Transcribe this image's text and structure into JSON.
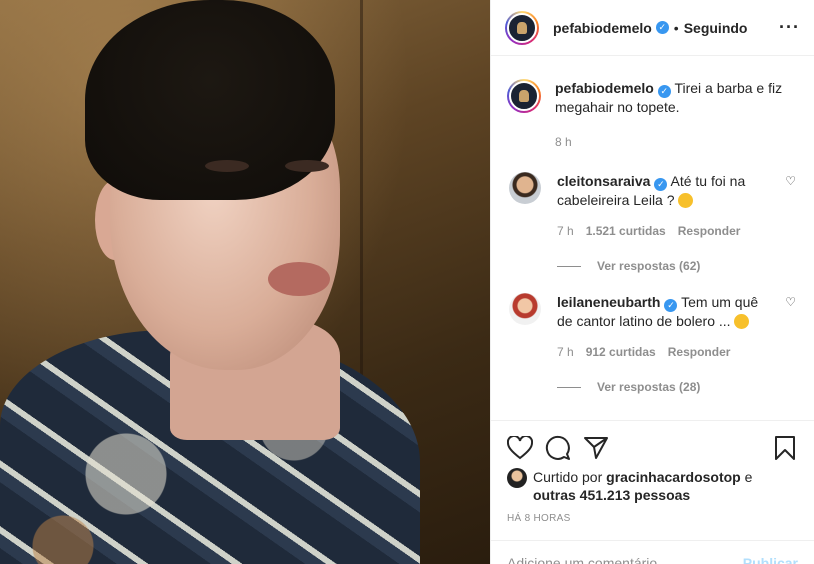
{
  "post": {
    "username": "pefabiodemelo",
    "follow_state": "Seguindo",
    "caption": "Tirei a barba e fiz megahair no topete.",
    "caption_age": "8 h"
  },
  "comments": [
    {
      "username": "cleitonsaraiva",
      "text": "Até tu foi na cabeleireira Leila ?",
      "age": "7 h",
      "likes": "1.521 curtidas",
      "reply": "Responder",
      "view_replies": "Ver respostas (62)"
    },
    {
      "username": "leilaneneubarth",
      "text": "Tem um quê de cantor latino de bolero ...",
      "age": "7 h",
      "likes": "912 curtidas",
      "reply": "Responder",
      "view_replies": "Ver respostas (28)"
    }
  ],
  "likes": {
    "prefix": "Curtido por",
    "user": "gracinhacardosotop",
    "and": "e",
    "others": "outras 451.213 pessoas"
  },
  "timestamp": "HÁ 8 HORAS",
  "add_comment": {
    "placeholder": "Adicione um comentário...",
    "publish": "Publicar"
  },
  "colors": {
    "verified": "#3897f0",
    "muted": "#8e8e8e",
    "publish_disabled": "#b2dffc"
  }
}
